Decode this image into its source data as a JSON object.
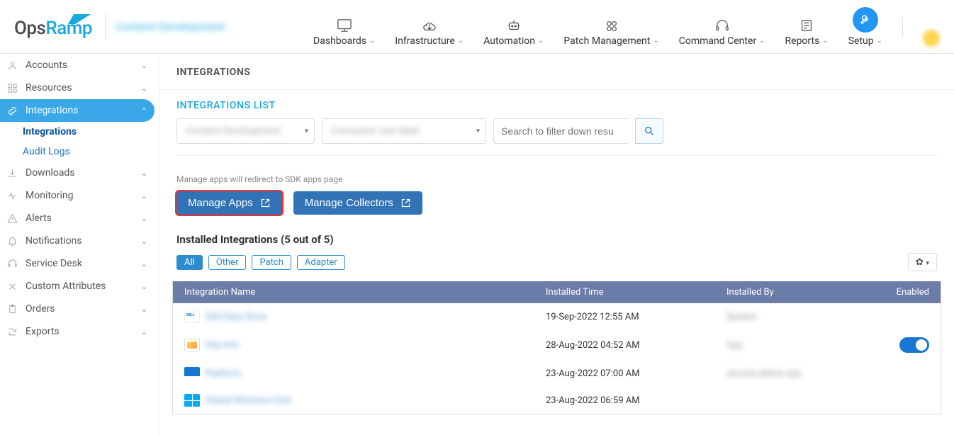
{
  "brand": {
    "part1": "Ops",
    "part2": "Ramp",
    "context": "Content Development"
  },
  "topnav": [
    {
      "label": "Dashboards",
      "icon": "layout"
    },
    {
      "label": "Infrastructure",
      "icon": "cloud"
    },
    {
      "label": "Automation",
      "icon": "robot"
    },
    {
      "label": "Patch Management",
      "icon": "patch"
    },
    {
      "label": "Command Center",
      "icon": "headset"
    },
    {
      "label": "Reports",
      "icon": "paper"
    }
  ],
  "setup_label": "Setup",
  "sidebar": {
    "items": [
      {
        "label": "Accounts",
        "icon": "user"
      },
      {
        "label": "Resources",
        "icon": "grid"
      },
      {
        "label": "Integrations",
        "icon": "link",
        "active": true,
        "children": [
          {
            "label": "Integrations",
            "bold": true,
            "active": true
          },
          {
            "label": "Audit Logs"
          }
        ]
      },
      {
        "label": "Downloads",
        "icon": "download"
      },
      {
        "label": "Monitoring",
        "icon": "monitor"
      },
      {
        "label": "Alerts",
        "icon": "alert"
      },
      {
        "label": "Notifications",
        "icon": "bell"
      },
      {
        "label": "Service Desk",
        "icon": "headset"
      },
      {
        "label": "Custom Attributes",
        "icon": "tools"
      },
      {
        "label": "Orders",
        "icon": "clipboard"
      },
      {
        "label": "Exports",
        "icon": "export"
      }
    ]
  },
  "page": {
    "title": "INTEGRATIONS",
    "list_label": "INTEGRATIONS  LIST",
    "select1": "Content Development",
    "select2": "Consumer unit label",
    "search_placeholder": "Search to filter down resu",
    "note": "Manage apps will redirect to SDK apps page",
    "btn_manage_apps": "Manage Apps",
    "btn_manage_collectors": "Manage Collectors",
    "installed_title": "Installed Integrations (5 out of 5)",
    "tags": [
      "All",
      "Other",
      "Patch",
      "Adapter"
    ],
    "columns": {
      "name": "Integration Name",
      "time": "Installed Time",
      "by": "Installed By",
      "enabled": "Enabled"
    },
    "rows": [
      {
        "icon": "dell",
        "name": "Dell Data Store",
        "time": "19-Sep-2022 12:55 AM",
        "by": "System",
        "toggle": false
      },
      {
        "icon": "badge",
        "name": "Site Info",
        "time": "28-Aug-2022 04:52 AM",
        "by": "Ops",
        "toggle": true
      },
      {
        "icon": "blue",
        "name": "Platform",
        "time": "23-Aug-2022 07:00 AM",
        "by": "service.admin.ops",
        "toggle": false
      },
      {
        "icon": "win",
        "name": "Global Windows Hub",
        "time": "23-Aug-2022 06:59 AM",
        "by": "",
        "toggle": false
      }
    ]
  }
}
